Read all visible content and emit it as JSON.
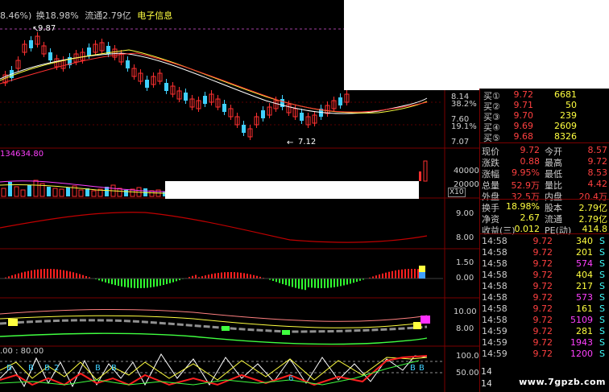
{
  "header": {
    "pct": "8.46%)",
    "turnover": "换18.98%",
    "float": "流通2.79亿",
    "sector": "电子信息"
  },
  "price_chart": {
    "high_marker": "9.87",
    "low_marker": "7.12",
    "right_axis": [
      "8.14",
      "38.2%",
      "7.60",
      "19.1%",
      "7.07"
    ]
  },
  "volume_panel": {
    "label": "134634.80",
    "right_axis": [
      "40000",
      "20000",
      "X10"
    ]
  },
  "panel3": {
    "right_axis": [
      "9.00",
      "8.00"
    ]
  },
  "panel4": {
    "right_axis": [
      "1.50",
      "0.00"
    ]
  },
  "panel5": {
    "right_axis": [
      "10.00",
      "8.00"
    ]
  },
  "panel6": {
    "label": ".00 : 80.00",
    "right_axis": [
      "100.0",
      "50.00"
    ],
    "b_marks": [
      "B",
      "B",
      "B",
      "2",
      "B",
      "B",
      "6",
      "B",
      "B"
    ]
  },
  "order_book": [
    {
      "label": "买①",
      "price": "9.72",
      "vol": "6681"
    },
    {
      "label": "买②",
      "price": "9.71",
      "vol": "50"
    },
    {
      "label": "买③",
      "price": "9.70",
      "vol": "239"
    },
    {
      "label": "买④",
      "price": "9.69",
      "vol": "2609"
    },
    {
      "label": "买⑤",
      "price": "9.68",
      "vol": "8326"
    }
  ],
  "quote": [
    {
      "l1": "现价",
      "v1": "9.72",
      "l2": "今开",
      "v2": "8.57"
    },
    {
      "l1": "涨跌",
      "v1": "0.88",
      "l2": "最高",
      "v2": "9.72"
    },
    {
      "l1": "涨幅",
      "v1": "9.95%",
      "l2": "最低",
      "v2": "8.53"
    },
    {
      "l1": "总量",
      "v1": "52.9万",
      "l2": "量比",
      "v2": "4.42"
    },
    {
      "l1": "外盘",
      "v1": "32.5万",
      "l2": "内盘",
      "v2": "20.4万"
    }
  ],
  "stats": [
    {
      "l1": "换手",
      "v1": "18.98%",
      "l2": "股本",
      "v2": "2.79亿"
    },
    {
      "l1": "净资",
      "v1": "2.67",
      "l2": "流通",
      "v2": "2.79亿"
    },
    {
      "l1": "收益(三)",
      "v1": "0.012",
      "l2": "PE(动)",
      "v2": "414.8"
    }
  ],
  "ticks": [
    {
      "time": "14:58",
      "price": "9.72",
      "vol": "340",
      "flag": "S"
    },
    {
      "time": "14:58",
      "price": "9.72",
      "vol": "201",
      "flag": "S"
    },
    {
      "time": "14:58",
      "price": "9.72",
      "vol": "574",
      "flag": "S"
    },
    {
      "time": "14:58",
      "price": "9.72",
      "vol": "404",
      "flag": "S"
    },
    {
      "time": "14:58",
      "price": "9.72",
      "vol": "217",
      "flag": "S"
    },
    {
      "time": "14:58",
      "price": "9.72",
      "vol": "573",
      "flag": "S"
    },
    {
      "time": "14:58",
      "price": "9.72",
      "vol": "161",
      "flag": "S"
    },
    {
      "time": "14:58",
      "price": "9.72",
      "vol": "5109",
      "flag": "S"
    },
    {
      "time": "14:59",
      "price": "9.72",
      "vol": "281",
      "flag": "S"
    },
    {
      "time": "14:59",
      "price": "9.72",
      "vol": "1943",
      "flag": "S"
    },
    {
      "time": "14:59",
      "price": "9.72",
      "vol": "1200",
      "flag": "S"
    }
  ],
  "partial_ticks": [
    "14",
    "14"
  ],
  "watermark": "www.7gpzb.com",
  "colors": {
    "up": "#ff3030",
    "down": "#40d0ff",
    "ma": "#ffffff"
  }
}
